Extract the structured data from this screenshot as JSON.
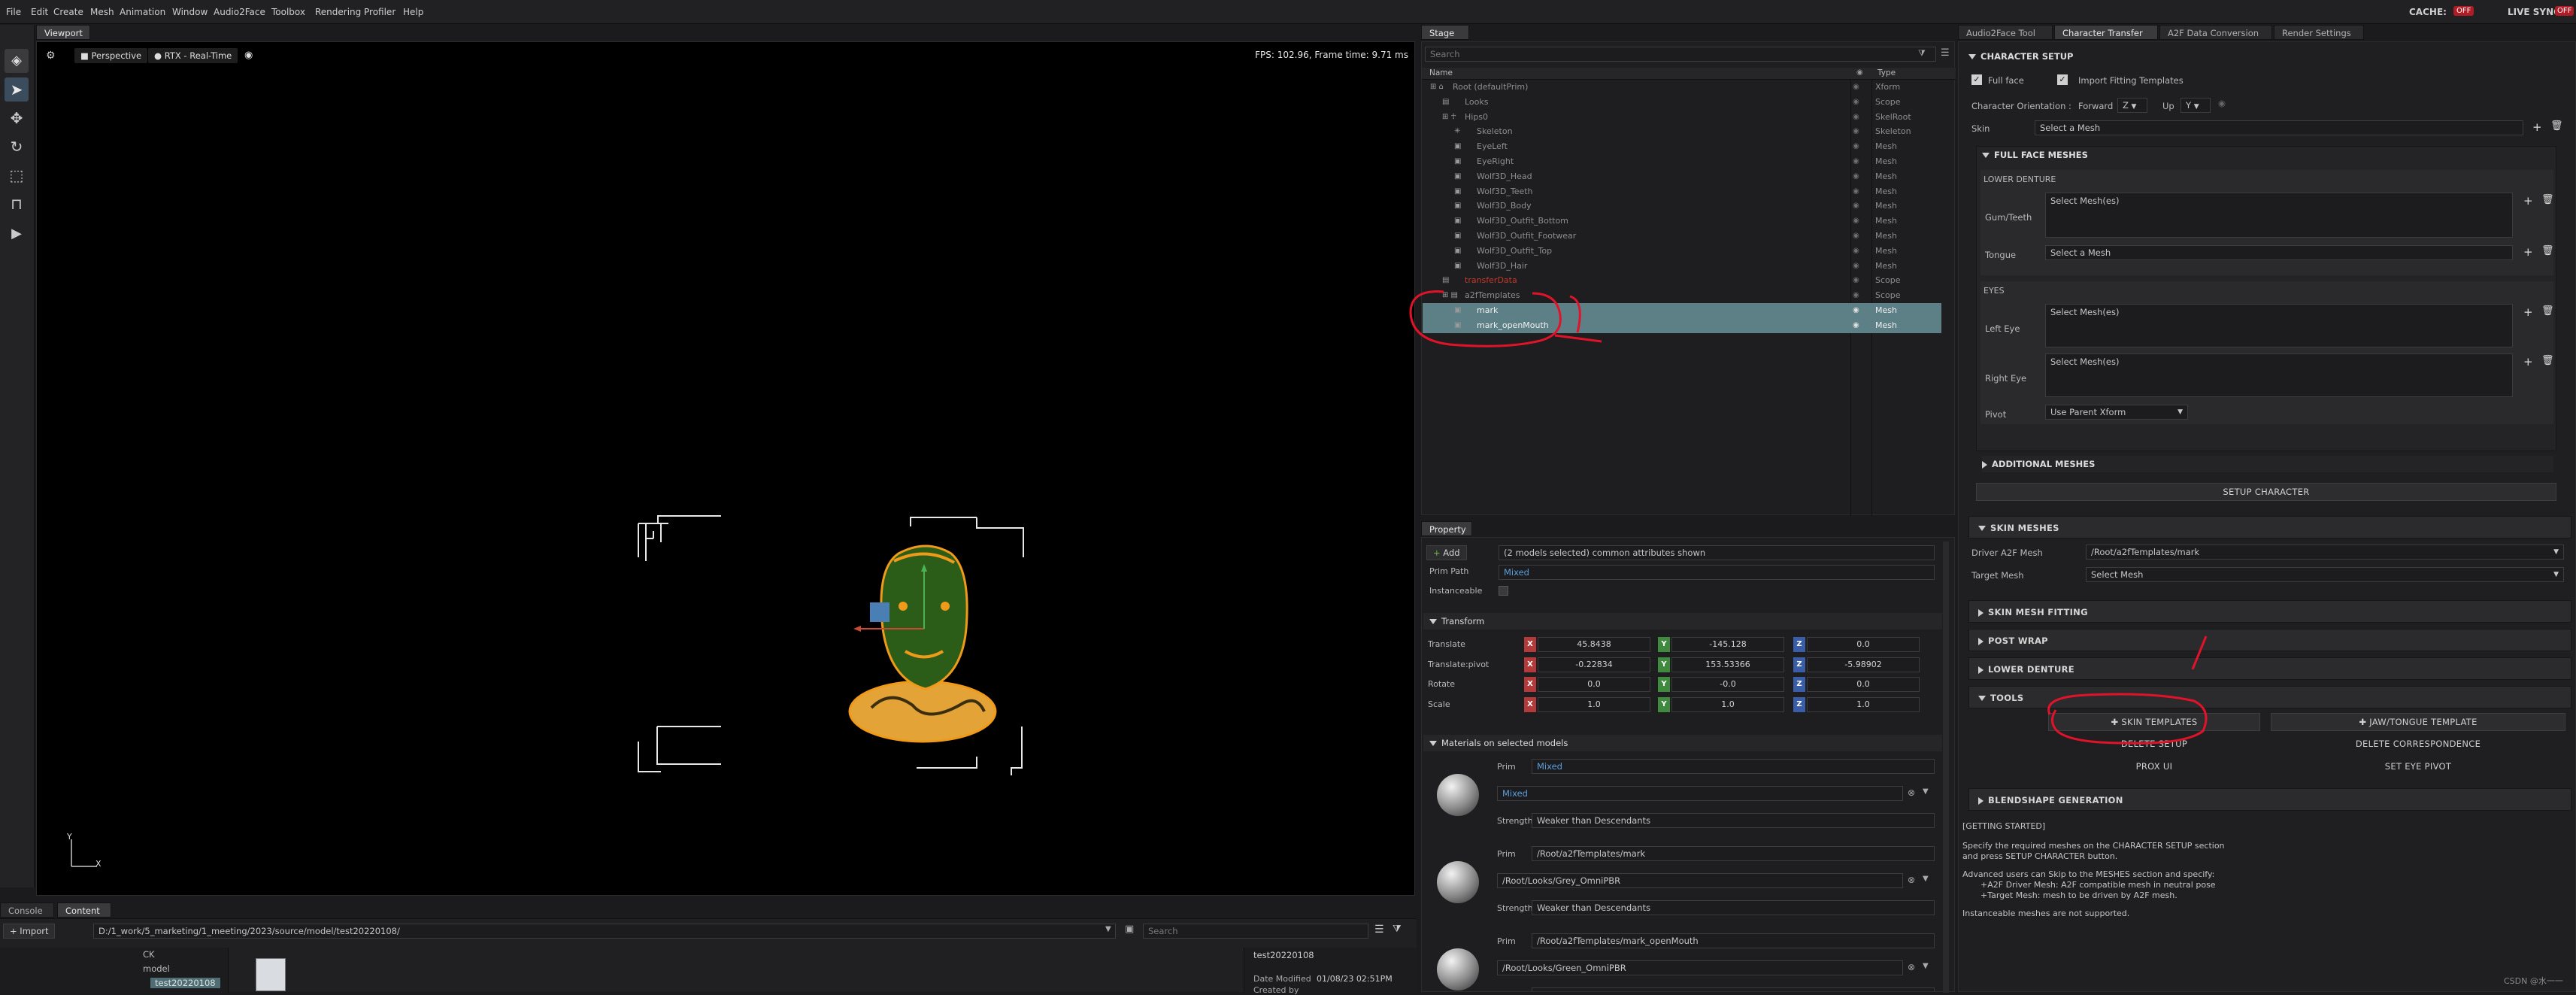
{
  "menu": [
    "File",
    "Edit",
    "Create",
    "Mesh",
    "Animation",
    "Window",
    "Audio2Face",
    "Toolbox",
    "Rendering",
    "Profiler",
    "Help"
  ],
  "status_right": {
    "cache_label": "CACHE:",
    "cache_value": "OFF",
    "live_sync_label": "LIVE SYNC:",
    "live_sync_value": "OFF"
  },
  "viewport": {
    "tab": "Viewport",
    "camera": "Perspective",
    "renderer": "RTX - Real-Time",
    "fps": "FPS: 102.96, Frame time: 9.71 ms",
    "axis_y": "Y",
    "axis_x": "X"
  },
  "bottom_tabs": [
    "Console",
    "Content"
  ],
  "content": {
    "import_label": "Import",
    "path": "D:/1_work/5_marketing/1_meeting/2023/source/model/test20220108/",
    "search_placeholder": "Search",
    "tree": [
      "CK",
      "model",
      "test20220108"
    ],
    "detail_title": "test20220108",
    "date_label": "Date Modified",
    "date_value": "01/08/23 02:51PM",
    "created_label": "Created by"
  },
  "stage": {
    "tab": "Stage",
    "search_placeholder": "Search",
    "col_name": "Name",
    "col_type": "Type",
    "rows": [
      {
        "name": "Root (defaultPrim)",
        "type": "Xform"
      },
      {
        "name": "Looks",
        "type": "Scope"
      },
      {
        "name": "Hips0",
        "type": "SkelRoot"
      },
      {
        "name": "Skeleton",
        "type": "Skeleton"
      },
      {
        "name": "EyeLeft",
        "type": "Mesh"
      },
      {
        "name": "EyeRight",
        "type": "Mesh"
      },
      {
        "name": "Wolf3D_Head",
        "type": "Mesh"
      },
      {
        "name": "Wolf3D_Teeth",
        "type": "Mesh"
      },
      {
        "name": "Wolf3D_Body",
        "type": "Mesh"
      },
      {
        "name": "Wolf3D_Outfit_Bottom",
        "type": "Mesh"
      },
      {
        "name": "Wolf3D_Outfit_Footwear",
        "type": "Mesh"
      },
      {
        "name": "Wolf3D_Outfit_Top",
        "type": "Mesh"
      },
      {
        "name": "Wolf3D_Hair",
        "type": "Mesh"
      },
      {
        "name": "transferData",
        "type": "Scope"
      },
      {
        "name": "a2fTemplates",
        "type": "Scope"
      },
      {
        "name": "mark",
        "type": "Mesh"
      },
      {
        "name": "mark_openMouth",
        "type": "Mesh"
      }
    ]
  },
  "property": {
    "tab": "Property",
    "add_label": "Add",
    "summary": "(2 models selected) common attributes shown",
    "prim_path_label": "Prim Path",
    "prim_path_value": "Mixed",
    "instanceable_label": "Instanceable",
    "transform_header": "Transform",
    "rows": [
      {
        "label": "Translate",
        "x": "45.8438",
        "y": "-145.128",
        "z": "0.0"
      },
      {
        "label": "Translate:pivot",
        "x": "-0.22834",
        "y": "153.53366",
        "z": "-5.98902"
      },
      {
        "label": "Rotate",
        "x": "0.0",
        "y": "-0.0",
        "z": "0.0"
      },
      {
        "label": "Scale",
        "x": "1.0",
        "y": "1.0",
        "z": "1.0"
      }
    ],
    "materials_header": "Materials on selected models",
    "materials": [
      {
        "prim_label": "Prim",
        "prim": "Mixed",
        "material": "Mixed",
        "strength_label": "Strength",
        "strength": "Weaker than Descendants"
      },
      {
        "prim_label": "Prim",
        "prim": "/Root/a2fTemplates/mark",
        "material": "/Root/Looks/Grey_OmniPBR",
        "strength_label": "Strength",
        "strength": "Weaker than Descendants"
      },
      {
        "prim_label": "Prim",
        "prim": "/Root/a2fTemplates/mark_openMouth",
        "material": "/Root/Looks/Green_OmniPBR",
        "strength_label": "Strength",
        "strength": "Weaker than Descendants"
      }
    ]
  },
  "right_tabs": [
    "Audio2Face Tool",
    "Character Transfer",
    "A2F Data Conversion",
    "Render Settings"
  ],
  "char": {
    "setup_header": "CHARACTER SETUP",
    "full_face": "Full face",
    "import_templates": "Import Fitting Templates",
    "orientation_label": "Character Orientation :",
    "forward_label": "Forward",
    "forward_value": "Z",
    "up_label": "Up",
    "up_value": "Y",
    "skin_label": "Skin",
    "skin_value": "Select a Mesh",
    "ffm_header": "FULL FACE MESHES",
    "lower_denture": "LOWER DENTURE",
    "gum_label": "Gum/Teeth",
    "gum_value": "Select Mesh(es)",
    "tongue_label": "Tongue",
    "tongue_value": "Select a Mesh",
    "eyes": "EYES",
    "left_eye_label": "Left Eye",
    "left_eye_value": "Select Mesh(es)",
    "right_eye_label": "Right Eye",
    "right_eye_value": "Select Mesh(es)",
    "pivot_label": "Pivot",
    "pivot_value": "Use Parent Xform",
    "additional": "ADDITIONAL MESHES",
    "setup_btn": "SETUP CHARACTER",
    "skin_meshes": "SKIN MESHES",
    "driver_label": "Driver A2F Mesh",
    "driver_value": "/Root/a2fTemplates/mark",
    "target_label": "Target Mesh",
    "target_value": "Select Mesh",
    "fitting": "SKIN MESH FITTING",
    "post_wrap": "POST WRAP",
    "lower_denture2": "LOWER DENTURE",
    "tools": "TOOLS",
    "skin_templates": "SKIN TEMPLATES",
    "jaw_template": "JAW/TONGUE TEMPLATE",
    "delete_setup": "DELETE SETUP",
    "delete_corr": "DELETE CORRESPONDENCE",
    "prox_ui": "PROX UI",
    "set_eye_pivot": "SET EYE PIVOT",
    "blendshape": "BLENDSHAPE GENERATION",
    "getting_started": "[GETTING STARTED]",
    "help1": "Specify the required meshes on the CHARACTER SETUP section",
    "help2": "and press SETUP CHARACTER button.",
    "help3": "Advanced users can Skip to the MESHES section and specify:",
    "help4": "+A2F Driver Mesh: A2F compatible mesh in neutral pose",
    "help5": "+Target Mesh: mesh to be driven by A2F mesh.",
    "help6": "Instanceable meshes are not supported."
  },
  "watermark": "CSDN @水一一",
  "colors": {
    "accent": "#4a7fb5",
    "selection": "#5d7f86",
    "annotation": "#e0132a",
    "mesh_outline": "#f09a1a",
    "mesh_fill": "#2c5d18"
  }
}
